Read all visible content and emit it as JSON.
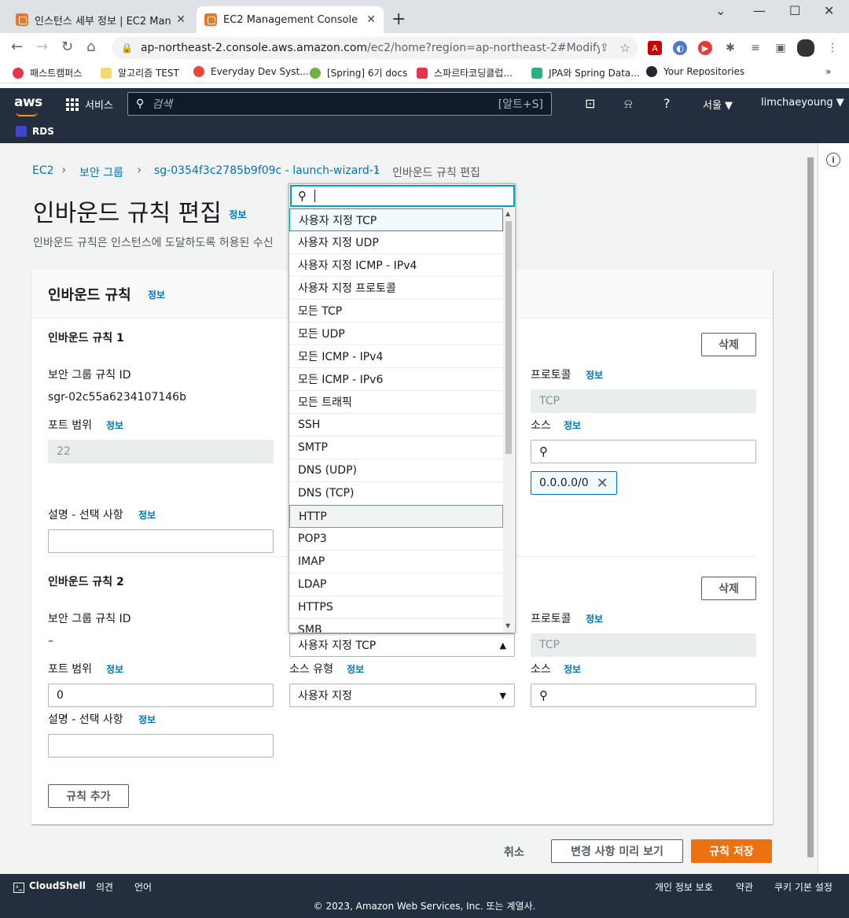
{
  "browser": {
    "tabs": [
      {
        "title": "인스턴스 세부 정보 | EC2 Manag",
        "active": false
      },
      {
        "title": "EC2 Management Console",
        "active": true
      }
    ],
    "url_host": "ap-northeast-2.console.aws.amazon.com",
    "url_path": "/ec2/home?region=ap-northeast-2#ModifyInb...",
    "bookmarks": [
      "패스트캠퍼스",
      "알고리즘 TEST",
      "Everyday Dev Syst...",
      "[Spring] 6기 docs",
      "스파르타코딩클럽...",
      "JPA와 Spring Data...",
      "Your Repositories"
    ],
    "bookmarks_more": "»"
  },
  "aws": {
    "logo": "aws",
    "services_label": "서비스",
    "search_placeholder": "검색",
    "search_shortcut": "[알트+S]",
    "region": "서울 ▼",
    "user": "limchaeyoung ▼",
    "service_shortcut": "RDS"
  },
  "breadcrumbs": [
    "EC2",
    "보안 그룹",
    "sg-0354f3c2785b9f09c - launch-wizard-1",
    "인바운드 규칙 편집"
  ],
  "page": {
    "title": "인바운드 규칙 편집",
    "title_info": "정보",
    "description": "인바운드 규칙은 인스턴스에 도달하도록 허용된 수신"
  },
  "panel": {
    "title": "인바운드 규칙",
    "info": "정보",
    "add_rule": "규칙 추가"
  },
  "labels": {
    "sg_rule_id": "보안 그룹 규칙 ID",
    "port_range": "포트 범위",
    "source_type": "소스 유형",
    "protocol": "프로토콜",
    "source": "소스",
    "description": "설명 - 선택 사항",
    "info": "정보",
    "delete": "삭제"
  },
  "rules": [
    {
      "heading": "인바운드 규칙 1",
      "rule_id": "sgr-02c55a6234107146b",
      "port_range": "22",
      "protocol": "TCP",
      "source_chip": "0.0.0.0/0"
    },
    {
      "heading": "인바운드 규칙 2",
      "rule_id": "–",
      "port_range": "0",
      "type": "사용자 지정 TCP",
      "source_type": "사용자 지정",
      "protocol": "TCP"
    }
  ],
  "dropdown": {
    "options": [
      "사용자 지정 TCP",
      "사용자 지정 UDP",
      "사용자 지정 ICMP - IPv4",
      "사용자 지정 프로토콜",
      "모든 TCP",
      "모든 UDP",
      "모든 ICMP - IPv4",
      "모든 ICMP - IPv6",
      "모든 트래픽",
      "SSH",
      "SMTP",
      "DNS (UDP)",
      "DNS (TCP)",
      "HTTP",
      "POP3",
      "IMAP",
      "LDAP",
      "HTTPS",
      "SMB"
    ],
    "selected_index": 0,
    "hover_index": 13
  },
  "actions": {
    "cancel": "취소",
    "preview": "변경 사항 미리 보기",
    "save": "규칙 저장"
  },
  "footer": {
    "cloudshell": "CloudShell",
    "feedback": "의견",
    "language": "언어",
    "privacy": "개인 정보 보호",
    "terms": "약관",
    "cookies": "쿠키 기본 설정",
    "copyright": "© 2023, Amazon Web Services, Inc. 또는 계열사."
  }
}
